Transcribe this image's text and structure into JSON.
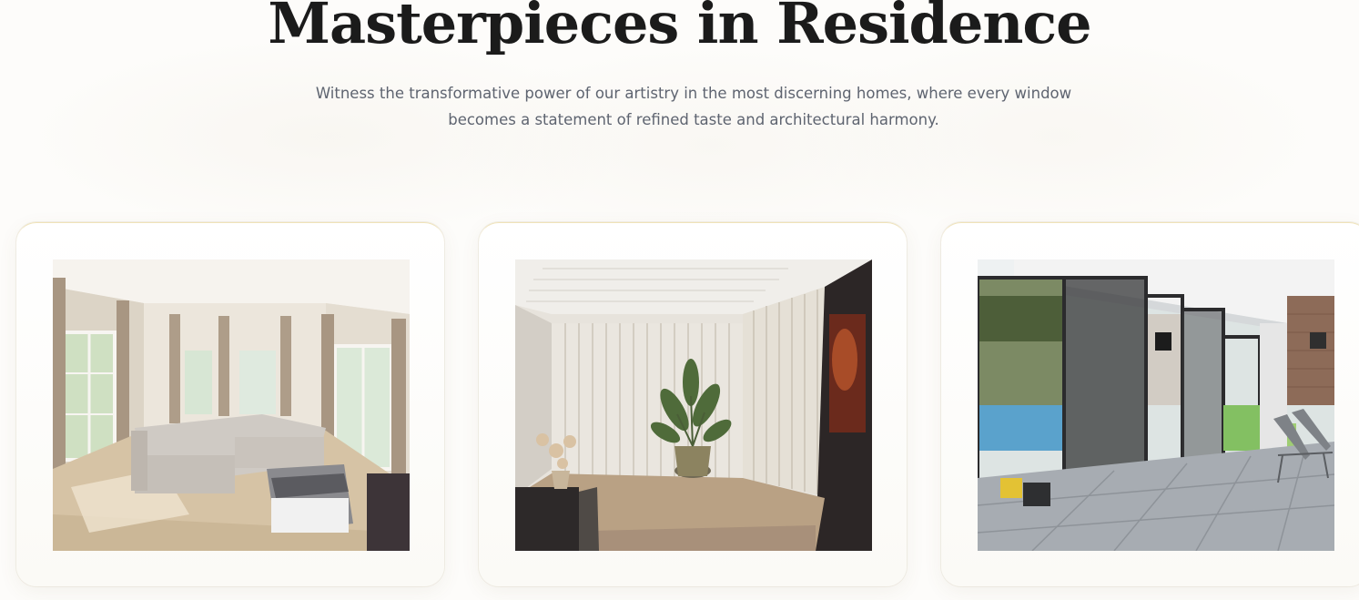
{
  "section": {
    "title": "Masterpieces in Residence",
    "subtitle": "Witness the transformative power of our artistry in the most discerning homes, where every window becomes a statement of refined taste and architectural harmony."
  },
  "gallery": {
    "items": [
      {
        "image": "living-room-with-curtains"
      },
      {
        "image": "living-room-with-vertical-blinds"
      },
      {
        "image": "patio-with-screen-doors"
      }
    ]
  },
  "colors": {
    "title": "#1b1b1b",
    "subtitle": "#5e6470",
    "card_accent": "#efe2b8"
  }
}
